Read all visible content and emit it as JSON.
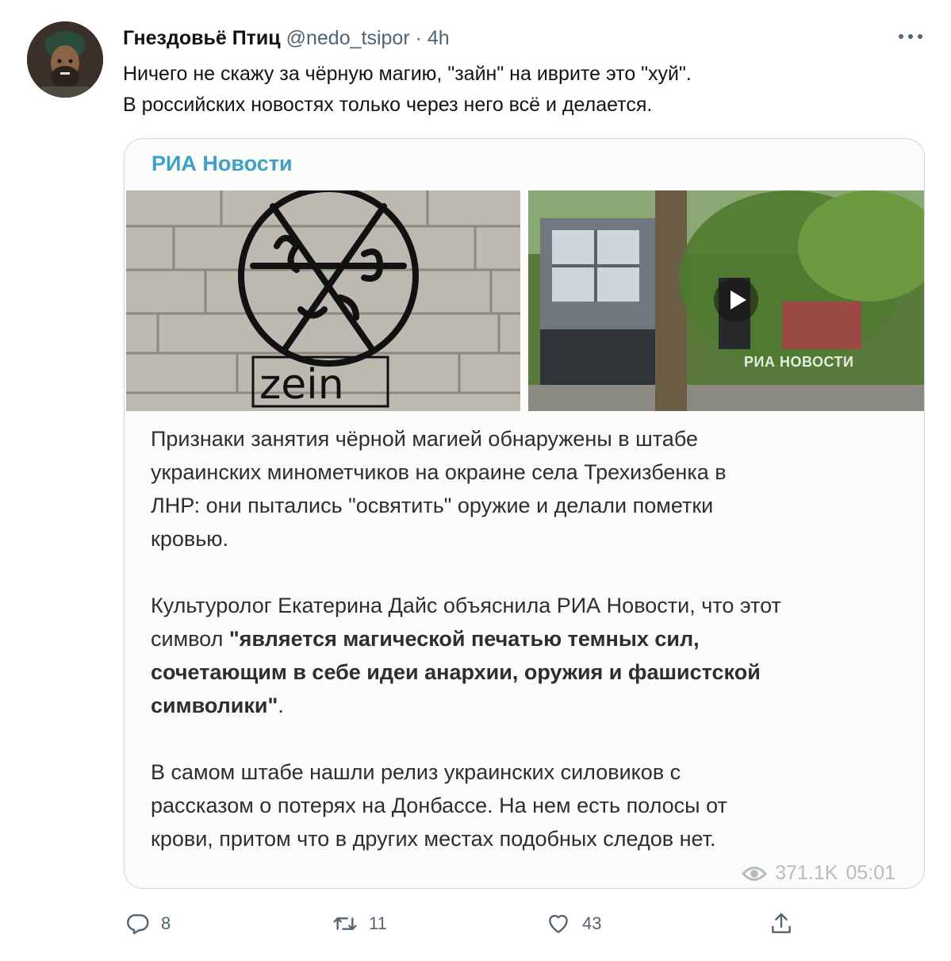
{
  "tweet": {
    "author_name": "Гнездовьё Птиц",
    "handle": "@nedo_tsipor",
    "separator": "·",
    "time": "4h",
    "text_lines": [
      "Ничего не скажу за чёрную магию, \"зайн\" на иврите это \"хуй\".",
      "В российских новостях только через него всё и делается."
    ]
  },
  "card": {
    "source": "РИА Новости",
    "graffiti_text": "zein",
    "video_watermark": "РИА НОВОСТИ",
    "paragraph1_lines": [
      "Признаки занятия чёрной магией обнаружены в штабе",
      "украинских минометчиков на окраине села Трехизбенка в",
      "ЛНР: они пытались \"освятить\" оружие и делали пометки",
      "кровью."
    ],
    "paragraph2_line1": "Культуролог Екатерина Дайс объяснила РИА Новости, что этот",
    "paragraph2_line2_plain": "символ ",
    "paragraph2_line2_bold": "\"является магической печатью темных сил,",
    "paragraph2_line3_bold": "сочетающим в себе идеи анархии, оружия и фашистской",
    "paragraph2_line4_bold": "символики\"",
    "paragraph2_line4_end": ".",
    "paragraph3_lines": [
      "В самом штабе нашли релиз украинских силовиков с",
      "рассказом о потерях на Донбассе. На нем есть полосы от",
      "крови, притом что в других местах подобных следов нет."
    ],
    "views": "371.1K",
    "post_time": "05:01"
  },
  "actions": {
    "reply_count": "8",
    "retweet_count": "11",
    "like_count": "43"
  },
  "icons": {
    "reply": "reply-icon",
    "retweet": "retweet-icon",
    "like": "heart-icon",
    "share": "share-icon",
    "more": "more-icon",
    "views": "eye-icon",
    "play": "play-icon"
  },
  "colors": {
    "text": "#0f1419",
    "secondary": "#536471",
    "border": "#cfd9de",
    "ria_accent": "#3ea0c7"
  }
}
